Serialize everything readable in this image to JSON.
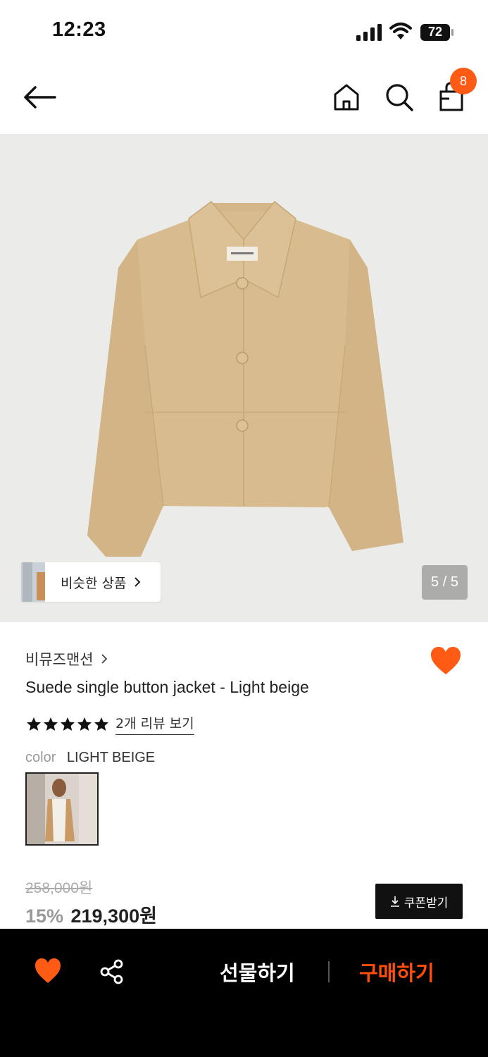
{
  "status_bar": {
    "time": "12:23",
    "battery": "72"
  },
  "header": {
    "cart_count": "8"
  },
  "gallery": {
    "similar_label": "비슷한 상품",
    "page_counter": "5 / 5"
  },
  "product": {
    "brand": "비뮤즈맨션",
    "title": "Suede single button jacket - Light beige",
    "rating_stars": 5,
    "review_link": "2개 리뷰 보기",
    "color_label": "color",
    "color_value": "LIGHT BEIGE",
    "original_price": "258,000원",
    "discount": "15%",
    "sale_price": "219,300원",
    "coupon_button": "쿠폰받기"
  },
  "bottom_bar": {
    "gift_label": "선물하기",
    "buy_label": "구매하기"
  },
  "colors": {
    "accent": "#ff5b14",
    "buy": "#ff4d0a",
    "jacket": "#d8bb8e"
  },
  "icons": [
    "back-arrow-icon",
    "home-icon",
    "search-icon",
    "shopping-bag-icon",
    "heart-icon",
    "share-icon",
    "download-icon",
    "star-icon",
    "chevron-right-icon"
  ]
}
